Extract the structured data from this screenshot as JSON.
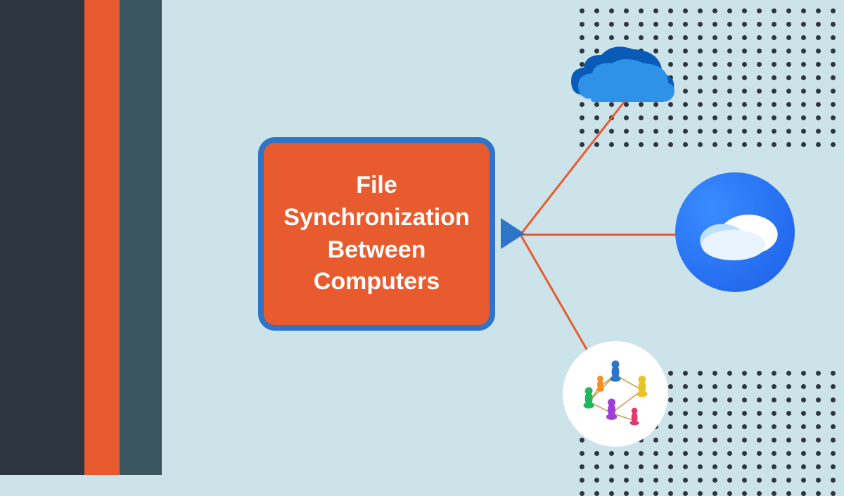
{
  "main": {
    "title": "File Synchronization Between Computers"
  },
  "nodes": {
    "onedrive": "OneDrive cloud",
    "cloudapp": "Cloud sync app",
    "network": "Network sharing"
  },
  "colors": {
    "accent": "#e85b2e",
    "frame": "#2e74c8",
    "bg": "#cce3ea",
    "dark": "#2e3641"
  }
}
